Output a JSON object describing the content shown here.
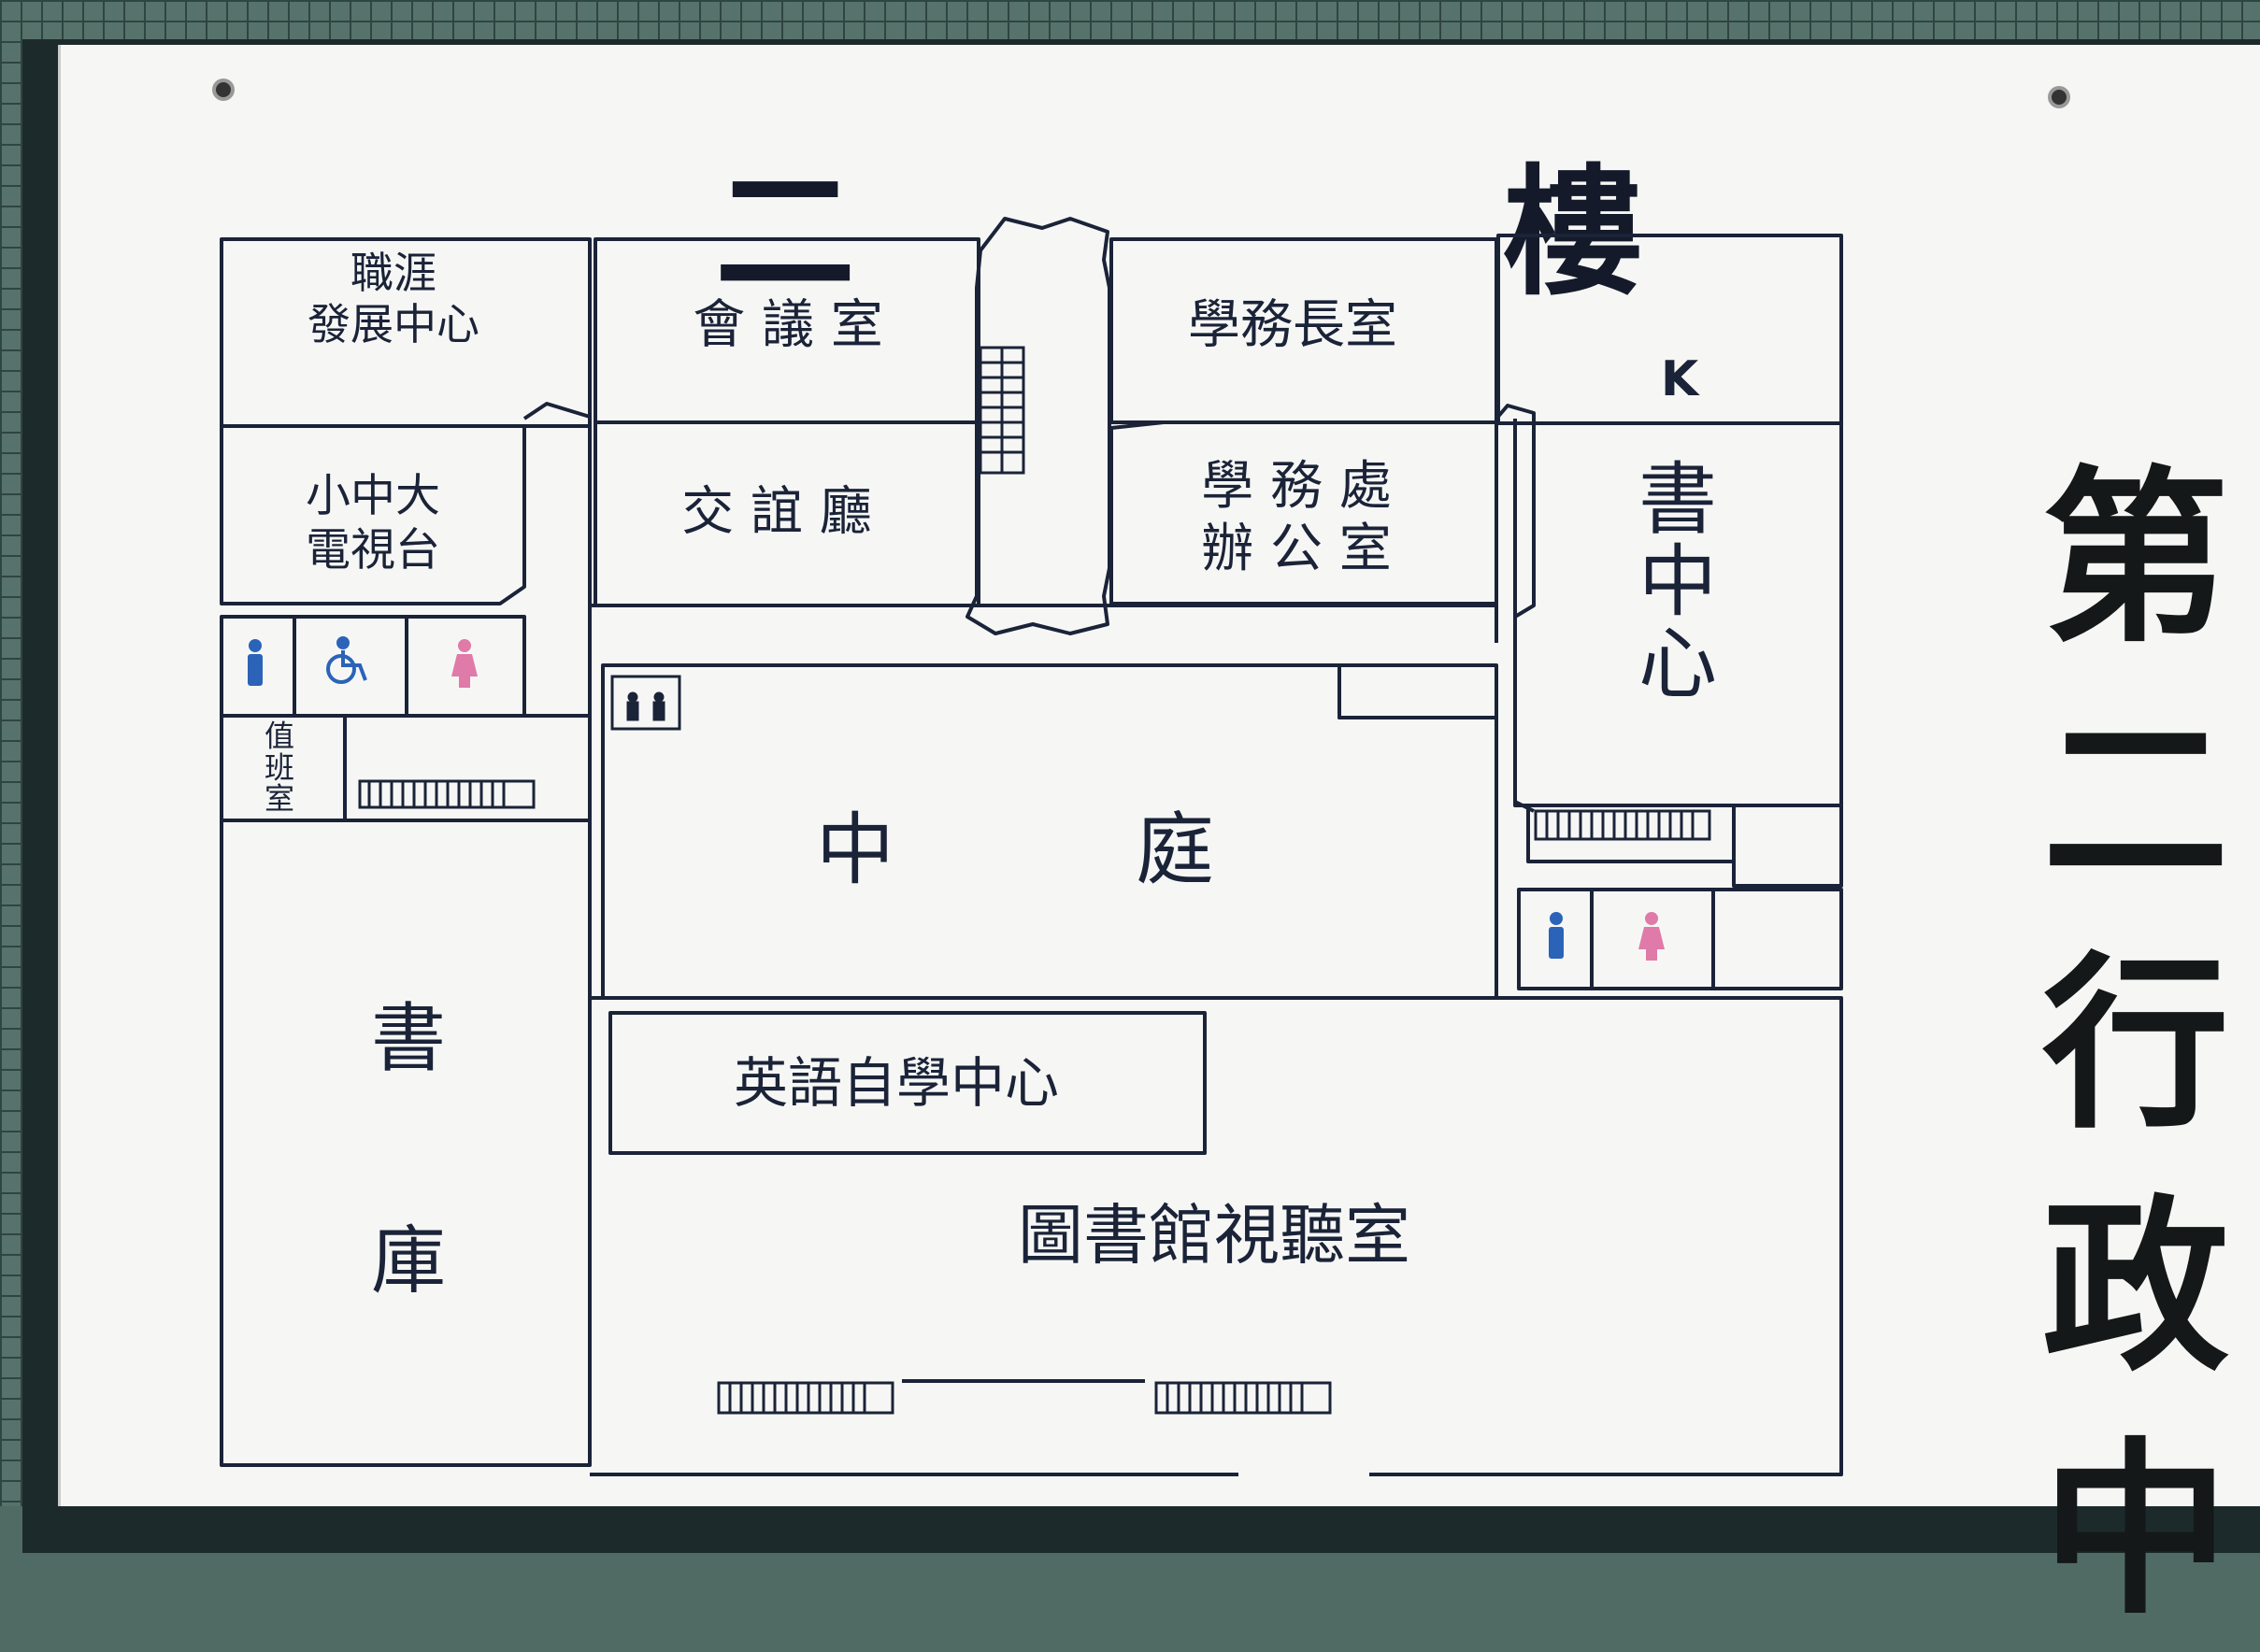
{
  "title": "二 樓",
  "side_text": "第二行政中",
  "rooms": {
    "career_center": "職涯\n發展中心",
    "meeting_room": "會 議 室",
    "dean_office": "學務長室",
    "k": "K",
    "social_hall": "交 誼 廳",
    "student_affairs": "學 務 處\n辦 公 室",
    "tv_station": "小中大\n電視台",
    "study_center": "書\n中\n心",
    "duty_room": "值\n班\n室",
    "courtyard_a": "中",
    "courtyard_b": "庭",
    "stack_a": "書",
    "stack_b": "庫",
    "english_center": "英語自學中心",
    "av_room": "圖書館視聽室"
  },
  "colors": {
    "line": "#1b2338",
    "board": "#f6f7f5",
    "male": "#2b63b8",
    "female": "#e07aa8"
  },
  "icons": [
    "male-restroom-icon",
    "accessible-icon",
    "female-restroom-icon",
    "elevator-icon",
    "staircase-icon"
  ]
}
